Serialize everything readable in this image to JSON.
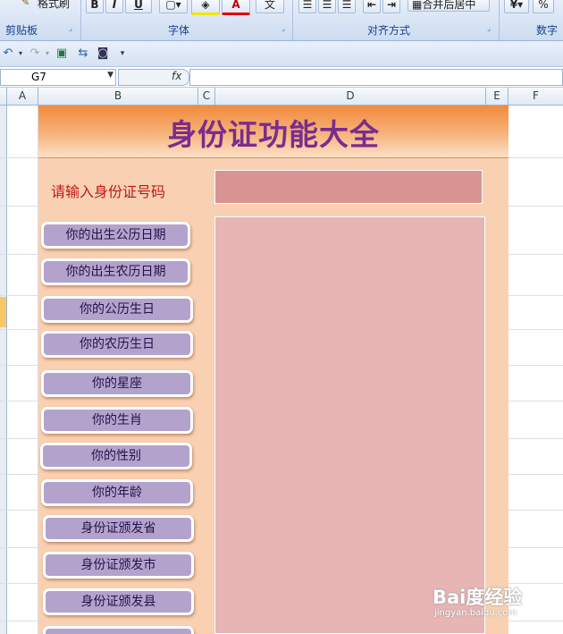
{
  "ribbon": {
    "groups": [
      {
        "label": "剪贴板"
      },
      {
        "label": "字体"
      },
      {
        "label": "对齐方式"
      },
      {
        "label": "数字"
      }
    ],
    "format_painter_label": "格式刷",
    "bold_label": "B",
    "italic_label": "I",
    "underline_label": "U",
    "font_color_label": "A",
    "phonetic_label": "文",
    "merge_center_label": "合并后居中",
    "percent_label": "%"
  },
  "namebox": {
    "value": "G7"
  },
  "formula": {
    "fx": "fx",
    "value": ""
  },
  "columns": [
    "A",
    "B",
    "C",
    "D",
    "E",
    "F"
  ],
  "panel": {
    "title": "身份证功能大全",
    "id_label": "请输入身份证号码",
    "id_value": "",
    "result_value": "",
    "buttons": [
      "你的出生公历日期",
      "你的出生农历日期",
      "你的公历生日",
      "你的农历生日",
      "你的星座",
      "你的生肖",
      "你的性别",
      "你的年龄",
      "身份证颁发省",
      "身份证颁发市",
      "身份证颁发县"
    ]
  },
  "watermark": {
    "logo_text": "Bai度经验",
    "url": "jingyan.baidu.com"
  },
  "colors": {
    "banner_title": "#7a2c8e",
    "label_red": "#c0161b",
    "button_fill": "#b3a3cc",
    "panel_bg": "#f9d1b2",
    "input_fill": "#d89493",
    "result_fill": "#e7b5b4"
  }
}
